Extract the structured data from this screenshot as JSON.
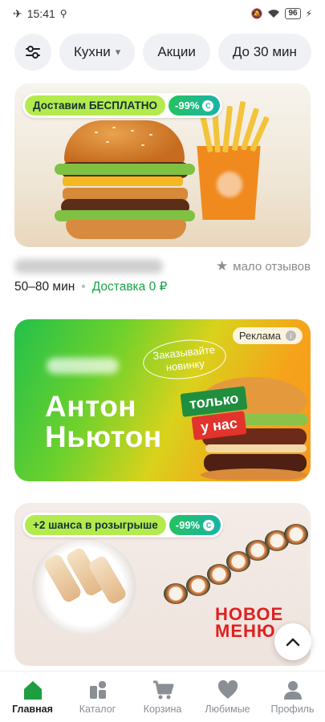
{
  "status_bar": {
    "time": "15:41",
    "battery": "96"
  },
  "filters": {
    "settings_icon": "sliders-icon",
    "chips": [
      {
        "label": "Кухни",
        "has_dropdown": true
      },
      {
        "label": "Акции"
      },
      {
        "label": "До 30 мин"
      }
    ]
  },
  "restaurant_card": {
    "badge_free_delivery": "Доставим БЕСПЛАТНО",
    "badge_discount": "-99%",
    "reviews": "мало отзывов",
    "delivery_time": "50–80 мин",
    "delivery_price": "Доставка 0 ₽"
  },
  "ad_card": {
    "badge": "Реклама",
    "bubble": "Заказывайте новинку",
    "title_line1": "Антон",
    "title_line2": "Ньютон",
    "tag_line1": "только",
    "tag_line2": "у нас"
  },
  "promo_card": {
    "badge_chances": "+2 шанса в розыгрыше",
    "badge_discount": "-99%",
    "new_menu_line1": "НОВОЕ",
    "new_menu_line2": "МЕНЮ"
  },
  "tabbar": {
    "items": [
      {
        "label": "Главная",
        "icon": "home-icon",
        "active": true
      },
      {
        "label": "Каталог",
        "icon": "catalog-icon"
      },
      {
        "label": "Корзина",
        "icon": "cart-icon"
      },
      {
        "label": "Любимые",
        "icon": "heart-icon"
      },
      {
        "label": "Профиль",
        "icon": "profile-icon"
      }
    ]
  },
  "colors": {
    "accent_green": "#1aa34a",
    "active_tab": "#1e9e3e",
    "inactive": "#8a8f96"
  }
}
